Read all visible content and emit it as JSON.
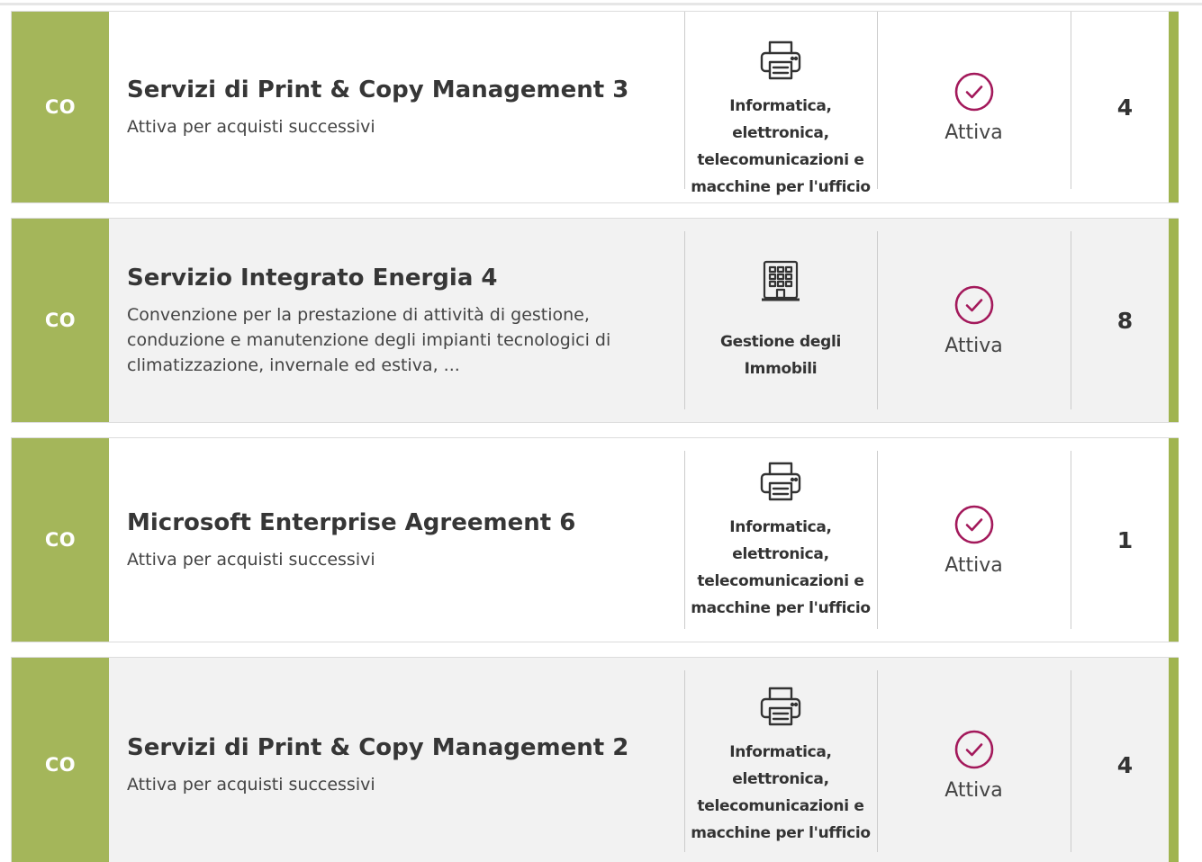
{
  "rows": [
    {
      "badge": "CO",
      "title": "Servizi di Print & Copy Management 3",
      "description": "Attiva per acquisti successivi",
      "category": {
        "icon": "printer-icon",
        "label": "Informatica, elettronica, telecomunicazioni e macchine per l'ufficio"
      },
      "status": {
        "icon": "check-circle-icon",
        "label": "Attiva"
      },
      "count": "4"
    },
    {
      "badge": "CO",
      "title": "Servizio Integrato Energia 4",
      "description": "Convenzione per la prestazione di attività di gestione, conduzione e manutenzione degli impianti tecnologici di climatizzazione, invernale ed estiva, ...",
      "category": {
        "icon": "building-icon",
        "label": "Gestione degli Immobili"
      },
      "status": {
        "icon": "check-circle-icon",
        "label": "Attiva"
      },
      "count": "8"
    },
    {
      "badge": "CO",
      "title": "Microsoft Enterprise Agreement 6",
      "description": "Attiva per acquisti successivi",
      "category": {
        "icon": "printer-icon",
        "label": "Informatica, elettronica, telecomunicazioni e macchine per l'ufficio"
      },
      "status": {
        "icon": "check-circle-icon",
        "label": "Attiva"
      },
      "count": "1"
    },
    {
      "badge": "CO",
      "title": "Servizi di Print & Copy Management 2",
      "description": "Attiva per acquisti successivi",
      "category": {
        "icon": "printer-icon",
        "label": "Informatica, elettronica, telecomunicazioni e macchine per l'ufficio"
      },
      "status": {
        "icon": "check-circle-icon",
        "label": "Attiva"
      },
      "count": "4"
    }
  ],
  "colors": {
    "badge_background": "#a4b65a",
    "accent_bar": "#a0b450",
    "status_icon": "#a3195b",
    "row_alt_background": "#f2f2f2"
  }
}
